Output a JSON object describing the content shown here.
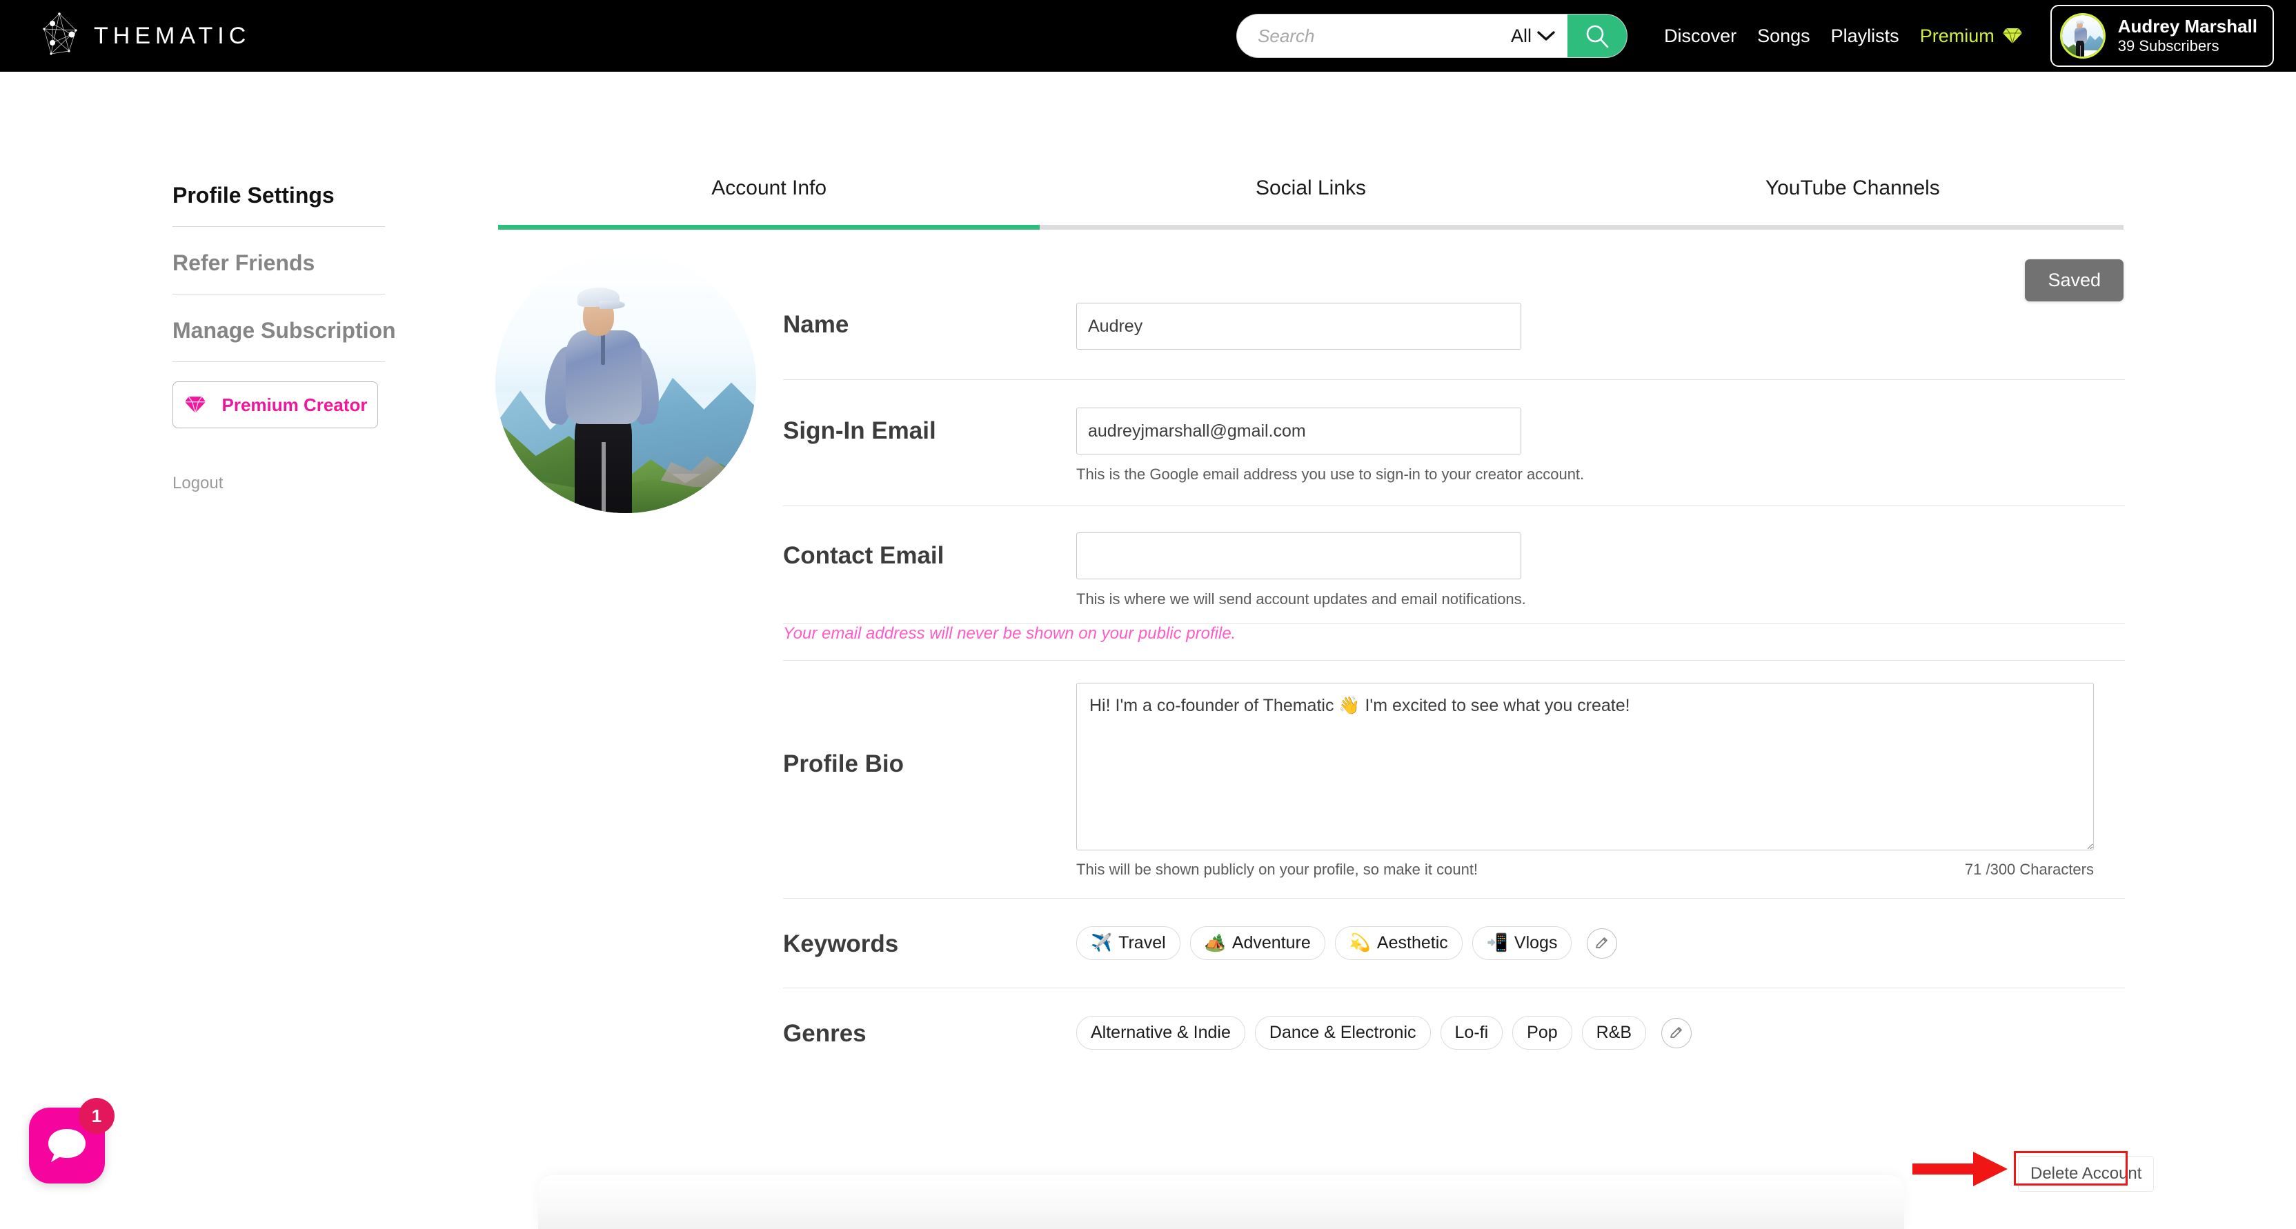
{
  "header": {
    "logo_text": "THEMATIC",
    "logo_icon": "thematic-constellation-logo",
    "search": {
      "placeholder": "Search",
      "value": "",
      "filter_label": "All",
      "filter_icon": "chevron-down-icon",
      "button_icon": "search-icon",
      "accent": "#2fbd7e"
    },
    "nav": [
      {
        "label": "Discover"
      },
      {
        "label": "Songs"
      },
      {
        "label": "Playlists"
      },
      {
        "label": "Premium",
        "icon": "diamond-icon",
        "color": "#d4ee3c"
      }
    ],
    "user": {
      "name": "Audrey Marshall",
      "subscribers": "39 Subscribers",
      "avatar_icon": "user-avatar"
    }
  },
  "sidebar": {
    "items": [
      {
        "label": "Profile Settings",
        "active": true
      },
      {
        "label": "Refer Friends",
        "active": false
      },
      {
        "label": "Manage Subscription",
        "active": false
      }
    ],
    "premium_button": {
      "label": "Premium Creator",
      "icon": "diamond-icon",
      "color": "#ef179c"
    },
    "logout_label": "Logout"
  },
  "tabs": [
    {
      "label": "Account Info",
      "active": true
    },
    {
      "label": "Social Links",
      "active": false
    },
    {
      "label": "YouTube Channels",
      "active": false
    }
  ],
  "saved_button": {
    "label": "Saved",
    "color": "#727272"
  },
  "form": {
    "name": {
      "label": "Name",
      "value": "Audrey",
      "placeholder": ""
    },
    "signin_email": {
      "label": "Sign-In Email",
      "value": "audreyjmarshall@gmail.com",
      "placeholder": "",
      "hint": "This is the Google email address you use to sign-in to your creator account."
    },
    "contact_email": {
      "label": "Contact Email",
      "value": "",
      "placeholder": "",
      "hint": "This is where we will send account updates and email notifications.",
      "privacy_note": "Your email address will never be shown on your public profile.",
      "privacy_note_color": "#ff5bc8"
    },
    "profile_bio": {
      "label": "Profile Bio",
      "value": "Hi! I'm a co-founder of Thematic 👋 I'm excited to see what you create!",
      "placeholder": "",
      "hint": "This will be shown publicly on your profile, so make it count!",
      "counter": "71 /300 Characters"
    },
    "keywords": {
      "label": "Keywords",
      "chips": [
        {
          "emoji": "✈️",
          "label": "Travel"
        },
        {
          "emoji": "🏕️",
          "label": "Adventure"
        },
        {
          "emoji": "💫",
          "label": "Aesthetic"
        },
        {
          "emoji": "📲",
          "label": "Vlogs"
        }
      ],
      "edit_icon": "pencil-icon"
    },
    "genres": {
      "label": "Genres",
      "chips": [
        {
          "label": "Alternative & Indie"
        },
        {
          "label": "Dance & Electronic"
        },
        {
          "label": "Lo-fi"
        },
        {
          "label": "Pop"
        },
        {
          "label": "R&B"
        }
      ],
      "edit_icon": "pencil-icon"
    }
  },
  "delete_account": {
    "label": "Delete Account"
  },
  "annotation": {
    "type": "red-arrow-and-box",
    "color": "#f01616",
    "points_to": "Delete Account"
  },
  "chat_widget": {
    "icon": "chat-bubble-icon",
    "badge": "1",
    "color": "#f5059e",
    "badge_color": "#e4175c"
  }
}
